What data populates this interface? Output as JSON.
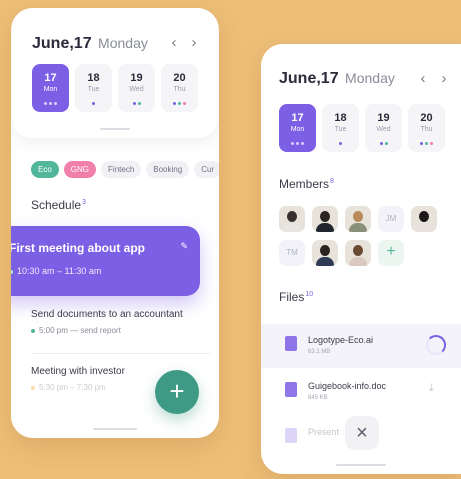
{
  "colors": {
    "background": "#EDBE78",
    "accent": "#7B5FE4",
    "fab": "#3E9A84",
    "eco_tag": "#52B69A",
    "gng_tag": "#F07FA9"
  },
  "left_screen": {
    "date": "June,17",
    "weekday": "Monday",
    "prev_icon": "chevron-left-icon",
    "next_icon": "chevron-right-icon",
    "days": [
      {
        "num": "17",
        "name": "Mon",
        "selected": true
      },
      {
        "num": "18",
        "name": "Tue"
      },
      {
        "num": "19",
        "name": "Wed"
      },
      {
        "num": "20",
        "name": "Thu"
      }
    ],
    "tags": [
      "Eco",
      "GNG",
      "Fintech",
      "Booking",
      "Cur"
    ],
    "schedule_title": "Schedule",
    "schedule_count": "3",
    "events": [
      {
        "title": "First meeting about app",
        "time": "10:30 am – 11:30 am"
      },
      {
        "title": "Send documents to an accountant",
        "time": "5:00 pm — send report"
      },
      {
        "title": "Meeting with investor",
        "time": "5:30 pm – 7:30 pm"
      }
    ],
    "fab_label": "+"
  },
  "right_screen": {
    "date": "June,17",
    "weekday": "Monday",
    "days": [
      {
        "num": "17",
        "name": "Mon",
        "selected": true
      },
      {
        "num": "18",
        "name": "Tue"
      },
      {
        "num": "19",
        "name": "Wed"
      },
      {
        "num": "20",
        "name": "Thu"
      }
    ],
    "members_title": "Members",
    "members_count": "8",
    "members": [
      {
        "type": "photo"
      },
      {
        "type": "photo"
      },
      {
        "type": "photo"
      },
      {
        "type": "initials",
        "text": "JM"
      },
      {
        "type": "photo"
      },
      {
        "type": "initials",
        "text": "TM"
      },
      {
        "type": "photo"
      },
      {
        "type": "photo"
      },
      {
        "type": "add",
        "text": "+"
      }
    ],
    "files_title": "Files",
    "files_count": "10",
    "files": [
      {
        "name": "Logotype-Eco.ai",
        "size": "63.1 MB",
        "active": true
      },
      {
        "name": "Guigebook-info.doc",
        "size": "845 KB"
      },
      {
        "name": "Present",
        "size": ""
      }
    ],
    "close_label": "×"
  }
}
